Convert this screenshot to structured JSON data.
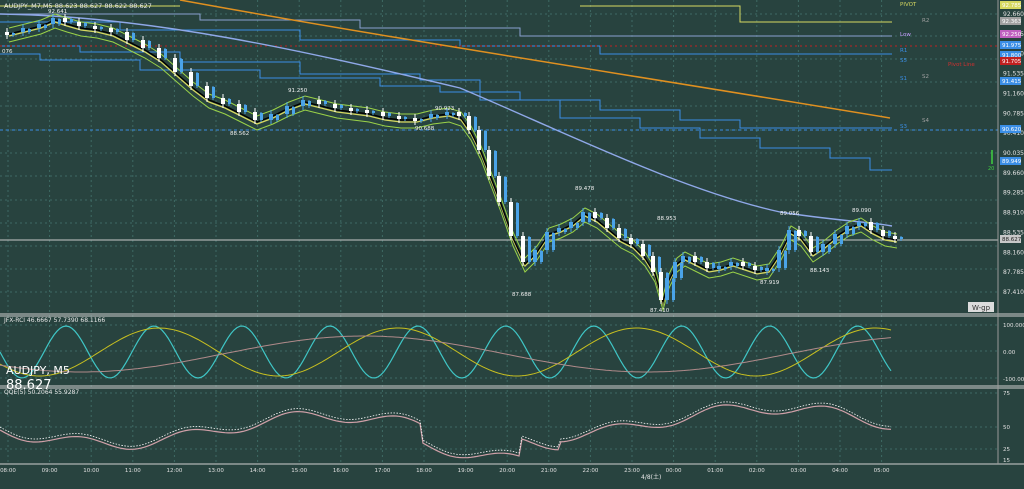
{
  "header": {
    "title": "AUDJPY_M7,M5  88.623 88.627 88.622 88.627"
  },
  "sub1_label": "JFX-RCI  46.6667  57.7390  68.1166",
  "sub2_label": "QQE(5)  50.2064  55.9287",
  "symbol_overlay": {
    "name": "AUDJPY, M5",
    "price": "88.627"
  },
  "watermark": "W-gp",
  "date_label": "4/8(土)",
  "peak_labels": [
    {
      "text": "92.641"
    },
    {
      "text": "91.250"
    },
    {
      "text": "90.923"
    },
    {
      "text": "90.688"
    },
    {
      "text": "88.562"
    },
    {
      "text": "89.478"
    },
    {
      "text": "88.953"
    },
    {
      "text": "89.056"
    },
    {
      "text": "89.090"
    },
    {
      "text": "87.688"
    },
    {
      "text": "87.410"
    },
    {
      "text": "87.919"
    },
    {
      "text": "88.143"
    },
    {
      "text": "076"
    }
  ],
  "level_labels": [
    {
      "text": "PIVOT",
      "color": "#d6d860"
    },
    {
      "text": "R2",
      "color": "#a0a0a0"
    },
    {
      "text": "Low",
      "color": "#c7a0ff"
    },
    {
      "text": "R1",
      "color": "#3a8ee6"
    },
    {
      "text": "Pivot Line",
      "color": "#d03030"
    },
    {
      "text": "S1",
      "color": "#3a8ee6"
    },
    {
      "text": "S2",
      "color": "#a0a0a0"
    },
    {
      "text": "S3",
      "color": "#3a8ee6"
    },
    {
      "text": "S4",
      "color": "#a0a0a0"
    },
    {
      "text": "S5",
      "color": "#3a8ee6"
    }
  ],
  "price_axis": [
    "92.660",
    "92.285",
    "91.910",
    "91.535",
    "91.160",
    "90.785",
    "90.410",
    "90.035",
    "89.660",
    "89.285",
    "88.910",
    "88.535",
    "88.160",
    "87.785",
    "87.410"
  ],
  "price_boxes": [
    {
      "text": "92.785",
      "color": "#d6d860"
    },
    {
      "text": "92.363",
      "color": "#a0a0a0"
    },
    {
      "text": "92.250",
      "color": "#c060c0"
    },
    {
      "text": "91.975",
      "color": "#3a8ee6"
    },
    {
      "text": "91.800",
      "color": "#3a8ee6"
    },
    {
      "text": "91.705",
      "color": "#c02020"
    },
    {
      "text": "91.415",
      "color": "#3a8ee6"
    },
    {
      "text": "90.620",
      "color": "#3a8ee6"
    },
    {
      "text": "89.949",
      "color": "#3a8ee6"
    },
    {
      "text": "88.627",
      "color": "#c8c8c8"
    }
  ],
  "sub1_axis": [
    "100.0000",
    "0.00",
    "-100.0000"
  ],
  "sub2_axis": [
    "75",
    "50",
    "25",
    "15"
  ],
  "time_axis": [
    "08:00",
    "09:00",
    "10:00",
    "11:00",
    "12:00",
    "13:00",
    "14:00",
    "15:00",
    "16:00",
    "17:00",
    "18:00",
    "19:00",
    "20:00",
    "21:00",
    "22:00",
    "23:00",
    "00:00",
    "01:00",
    "02:00",
    "03:00",
    "04:00",
    "05:00"
  ],
  "colors": {
    "background": "#28433f",
    "grid": "#3e6a64",
    "bull": "#4aa3e8",
    "bear": "#ffffff",
    "ma_fast": "#d6d860",
    "ma_mid": "#000000",
    "ma_envelope": "#9bd348",
    "ma_long": "#8fa8e8",
    "ma_trend": "#e09020",
    "rci_fast": "#3fc6c6",
    "rci_mid": "#c8c020",
    "rci_slow": "#b08a8a",
    "qqe_main": "#d0a0a8",
    "qqe_signal": "#ffffff"
  }
}
